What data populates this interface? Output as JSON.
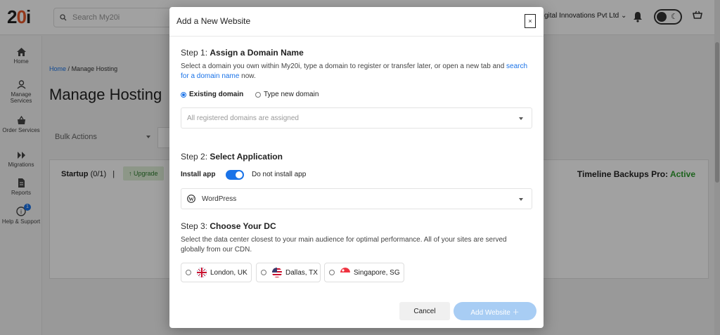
{
  "app": {
    "logo_text_pre": "2",
    "logo_text_o": "0",
    "logo_text_post": "i",
    "search_placeholder": "Search My20i",
    "account_name": "gital Innovations Pvt Ltd",
    "account_caret": "⌄"
  },
  "sidebar": {
    "items": [
      {
        "label": "Home",
        "icon": "home-icon"
      },
      {
        "label": "Manage Services",
        "icon": "manage-services-icon"
      },
      {
        "label": "Order Services",
        "icon": "order-services-icon"
      },
      {
        "label": "Migrations",
        "icon": "migrations-icon"
      },
      {
        "label": "Reports",
        "icon": "reports-icon"
      },
      {
        "label": "Help & Support",
        "icon": "help-icon",
        "badge": "1"
      }
    ]
  },
  "page": {
    "breadcrumb_home": "Home",
    "breadcrumb_sep": "/",
    "breadcrumb_current": "Manage Hosting",
    "title": "Manage Hosting",
    "bulk_actions": "Bulk Actions",
    "card_title": "Startup",
    "card_count": "(0/1)",
    "card_sep": "|",
    "upgrade_label": "↑ Upgrade",
    "backups_label": "Timeline Backups Pro:",
    "backups_status": "Active"
  },
  "modal": {
    "title": "Add a New Website",
    "close_label": "×",
    "step1": {
      "prefix": "Step 1:",
      "title": "Assign a Domain Name",
      "desc_part1": "Select a domain you own within My20i, type a domain to register or transfer later, or open a new tab and",
      "desc_link": "search for a domain name",
      "desc_part2": "now.",
      "option_existing": "Existing domain",
      "option_new": "Type new domain",
      "select_placeholder": "All registered domains are assigned"
    },
    "step2": {
      "prefix": "Step 2:",
      "title": "Select Application",
      "install_label": "Install app",
      "no_install_label": "Do not install app",
      "app_selected": "WordPress"
    },
    "step3": {
      "prefix": "Step 3:",
      "title": "Choose Your DC",
      "desc": "Select the data center closest to your main audience for optimal performance. All of your sites are served globally from our CDN.",
      "options": [
        "London, UK",
        "Dallas, TX",
        "Singapore, SG"
      ]
    },
    "cancel_label": "Cancel",
    "add_label": "Add Website ＋"
  },
  "colors": {
    "accent": "#1a73e8",
    "add_button": "#a8cdf4",
    "active_green": "#2e9d2e",
    "logo_orange": "#e8582a"
  }
}
